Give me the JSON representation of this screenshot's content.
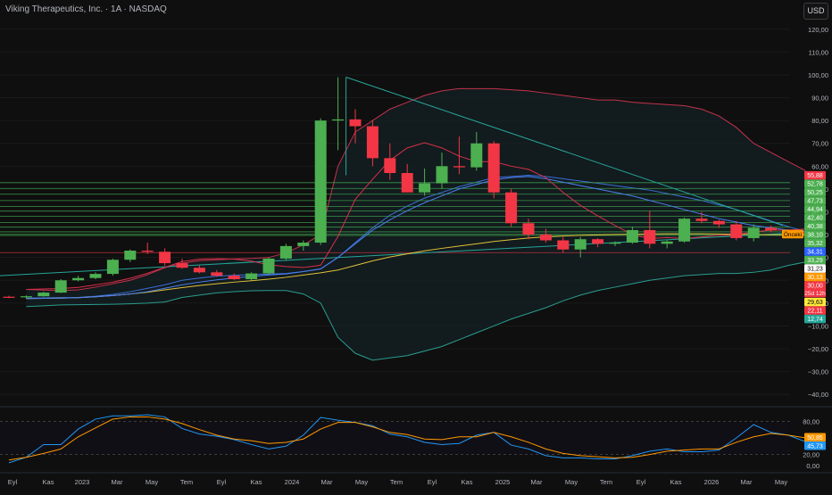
{
  "header": {
    "title": "Viking Therapeutics, Inc. · 1A · NASDAQ",
    "currency_button": "USD"
  },
  "chart_data": {
    "type": "candlestick",
    "title": "Viking Therapeutics, Inc. · 1A · NASDAQ",
    "x_tick_labels": [
      "Eyl",
      "Kas",
      "2023",
      "Mar",
      "May",
      "Tem",
      "Eyl",
      "Kas",
      "2024",
      "Mar",
      "May",
      "Tem",
      "Eyl",
      "Kas",
      "2025",
      "Mar",
      "May",
      "Tem",
      "Eyl",
      "Kas",
      "2026",
      "Mar",
      "May"
    ],
    "y_ticks": [
      120,
      110,
      100,
      90,
      80,
      70,
      60,
      50,
      40,
      30,
      20,
      10,
      0,
      -10,
      -20,
      -30,
      -40
    ],
    "y_tick_labels": [
      "120,00",
      "110,00",
      "100,00",
      "90,00",
      "80,00",
      "70,00",
      "60,00",
      "50,00",
      "40,00",
      "30,00",
      "20,00",
      "10,00",
      "0,0000",
      "−10,00",
      "−20,00",
      "−30,00",
      "−40,00"
    ],
    "ylim": [
      -45,
      125
    ],
    "candles": [
      {
        "o": 2.8,
        "h": 3.2,
        "l": 2.2,
        "c": 2.6
      },
      {
        "o": 2.6,
        "h": 3.4,
        "l": 2.1,
        "c": 3.0
      },
      {
        "o": 3.0,
        "h": 5.0,
        "l": 2.8,
        "c": 4.6
      },
      {
        "o": 4.6,
        "h": 10.5,
        "l": 4.4,
        "c": 10.0
      },
      {
        "o": 10.0,
        "h": 12.0,
        "l": 9.5,
        "c": 11.0
      },
      {
        "o": 11.0,
        "h": 13.5,
        "l": 10.5,
        "c": 12.8
      },
      {
        "o": 12.8,
        "h": 19.5,
        "l": 12.0,
        "c": 19.0
      },
      {
        "o": 19.0,
        "h": 23.5,
        "l": 18.0,
        "c": 23.0
      },
      {
        "o": 23.0,
        "h": 26.5,
        "l": 21.5,
        "c": 22.5
      },
      {
        "o": 22.5,
        "h": 24.0,
        "l": 16.5,
        "c": 17.5
      },
      {
        "o": 17.5,
        "h": 19.5,
        "l": 15.0,
        "c": 15.5
      },
      {
        "o": 15.5,
        "h": 16.5,
        "l": 13.0,
        "c": 13.5
      },
      {
        "o": 13.5,
        "h": 14.5,
        "l": 11.5,
        "c": 12.0
      },
      {
        "o": 12.0,
        "h": 13.0,
        "l": 10.0,
        "c": 10.5
      },
      {
        "o": 10.5,
        "h": 13.5,
        "l": 10.0,
        "c": 13.0
      },
      {
        "o": 13.0,
        "h": 20.0,
        "l": 12.5,
        "c": 19.5
      },
      {
        "o": 19.5,
        "h": 26.0,
        "l": 18.5,
        "c": 25.0
      },
      {
        "o": 25.0,
        "h": 27.5,
        "l": 23.0,
        "c": 26.5
      },
      {
        "o": 26.5,
        "h": 81.0,
        "l": 25.5,
        "c": 80.0
      },
      {
        "o": 80.0,
        "h": 99.0,
        "l": 67.0,
        "c": 80.5
      },
      {
        "o": 80.5,
        "h": 85.0,
        "l": 70.0,
        "c": 77.5
      },
      {
        "o": 77.5,
        "h": 80.0,
        "l": 60.0,
        "c": 63.5
      },
      {
        "o": 63.5,
        "h": 70.0,
        "l": 54.0,
        "c": 57.0
      },
      {
        "o": 57.0,
        "h": 61.0,
        "l": 49.0,
        "c": 48.5
      },
      {
        "o": 48.5,
        "h": 59.0,
        "l": 47.0,
        "c": 52.5
      },
      {
        "o": 52.5,
        "h": 66.0,
        "l": 50.0,
        "c": 60.0
      },
      {
        "o": 60.0,
        "h": 73.0,
        "l": 56.5,
        "c": 59.5
      },
      {
        "o": 59.5,
        "h": 75.0,
        "l": 58.0,
        "c": 70.0
      },
      {
        "o": 70.0,
        "h": 71.0,
        "l": 46.0,
        "c": 48.5
      },
      {
        "o": 48.5,
        "h": 50.0,
        "l": 33.5,
        "c": 35.0
      },
      {
        "o": 35.0,
        "h": 37.0,
        "l": 28.0,
        "c": 30.0
      },
      {
        "o": 30.0,
        "h": 32.5,
        "l": 26.5,
        "c": 27.5
      },
      {
        "o": 27.5,
        "h": 29.0,
        "l": 22.0,
        "c": 23.5
      },
      {
        "o": 23.5,
        "h": 29.0,
        "l": 20.0,
        "c": 28.0
      },
      {
        "o": 28.0,
        "h": 28.5,
        "l": 24.5,
        "c": 26.0
      },
      {
        "o": 26.0,
        "h": 27.0,
        "l": 25.0,
        "c": 26.5
      },
      {
        "o": 26.5,
        "h": 33.5,
        "l": 26.0,
        "c": 32.0
      },
      {
        "o": 32.0,
        "h": 40.5,
        "l": 24.0,
        "c": 26.0
      },
      {
        "o": 26.0,
        "h": 27.5,
        "l": 24.0,
        "c": 27.0
      },
      {
        "o": 27.0,
        "h": 37.5,
        "l": 26.5,
        "c": 37.0
      },
      {
        "o": 37.0,
        "h": 40.0,
        "l": 35.0,
        "c": 36.0
      },
      {
        "o": 36.0,
        "h": 36.5,
        "l": 33.0,
        "c": 34.5
      },
      {
        "o": 34.5,
        "h": 36.0,
        "l": 27.5,
        "c": 28.5
      },
      {
        "o": 28.5,
        "h": 34.5,
        "l": 27.0,
        "c": 33.0
      },
      {
        "o": 33.0,
        "h": 34.0,
        "l": 31.0,
        "c": 31.8
      },
      {
        "o": 31.8,
        "h": 32.5,
        "l": 30.5,
        "c": 31.0
      },
      {
        "o": 31.0,
        "h": 31.5,
        "l": 29.5,
        "c": 30.0
      }
    ],
    "bollinger_upper": [
      6,
      5.7,
      5.5,
      5.8,
      7,
      8.5,
      10,
      12.5,
      15.5,
      17.5,
      18.6,
      19,
      19.4,
      19.6,
      20,
      22,
      25.5,
      30,
      60,
      75,
      80,
      85,
      88,
      91,
      93,
      94,
      94,
      94,
      93.5,
      93,
      92,
      91,
      90,
      89,
      89,
      88,
      87.5,
      87,
      86.5,
      85,
      82,
      77,
      70,
      66,
      62,
      58
    ],
    "bollinger_middle": [
      2.2,
      2.3,
      2.4,
      2.5,
      3,
      3.8,
      5,
      6.5,
      8,
      10,
      11,
      11.8,
      12.2,
      12.5,
      12.7,
      13,
      13.8,
      15,
      20,
      26.5,
      33,
      38.5,
      42.5,
      46,
      48.5,
      51,
      53,
      55,
      55.5,
      56,
      55.5,
      54.5,
      53.5,
      52.5,
      51.5,
      50.5,
      49.5,
      48,
      46.5,
      45,
      43,
      41,
      38.5,
      36,
      33.5,
      31.5
    ],
    "bollinger_lower": [
      -1.5,
      -1.2,
      -0.8,
      -0.7,
      -0.6,
      -0.5,
      -0.3,
      0,
      0.5,
      2.5,
      3.5,
      4.5,
      5,
      5.4,
      5.5,
      5.5,
      4,
      0,
      -15,
      -22,
      -25,
      -24,
      -23,
      -21,
      -19,
      -16,
      -13,
      -10,
      -7,
      -4.5,
      -2,
      1,
      3.5,
      5.5,
      7,
      8.5,
      10,
      11,
      12,
      12.5,
      13,
      13,
      13.5,
      14.5,
      16.5,
      18
    ],
    "series_ma_yellow": [
      2,
      2.1,
      2.2,
      2.4,
      2.8,
      3.3,
      4,
      4.8,
      5.8,
      6.8,
      7.7,
      8.5,
      9.2,
      9.8,
      10.5,
      11.3,
      12.3,
      13.3,
      14.5,
      16.5,
      18.5,
      20.2,
      21.6,
      22.9,
      24,
      25,
      26,
      27,
      27.8,
      28.5,
      29,
      29.4,
      29.7,
      29.9,
      30.1,
      30.2,
      30.3,
      30.4,
      30.4,
      30.4,
      30.3,
      30.2,
      30.1,
      30,
      29.9,
      29.8
    ],
    "series_ma_blue": [
      2,
      2.1,
      2.2,
      2.4,
      2.8,
      3.3,
      4,
      5,
      6.5,
      8,
      9.2,
      10.2,
      11,
      11.7,
      12.3,
      12.8,
      13.8,
      15,
      20,
      26,
      32,
      36.5,
      40.5,
      44,
      47,
      50,
      52,
      54,
      55,
      55.5,
      54.5,
      53,
      51.5,
      50,
      48.5,
      47,
      45,
      43,
      41,
      39,
      37,
      35.5,
      34,
      33,
      32,
      31.3
    ],
    "ma_red_short": [
      6,
      6.2,
      6.4,
      6.9,
      8,
      9.2,
      10.9,
      13.1,
      15.7,
      18.2,
      19.3,
      19.5,
      19.3,
      18.4,
      16.8,
      16,
      15.6,
      16.6,
      29.2,
      45.5,
      54.3,
      62.6,
      68,
      70.3,
      68,
      64.4,
      62,
      62,
      60,
      58.6,
      55,
      48.5,
      42.8,
      38.2,
      34,
      30,
      28.3,
      28.7,
      28.3,
      29,
      29.7,
      30,
      31.2,
      32,
      32,
      32.5
    ],
    "trend_line_top": [
      [
        98.5,
        99
      ],
      [
        438,
        34
      ]
    ],
    "trend_line_bottom": [
      [
        0,
        12
      ],
      [
        438,
        30.5
      ]
    ],
    "horizontal_levels": [
      52.78,
      50.25,
      47.73,
      44.94,
      42.4,
      40.38,
      38.1,
      35.32,
      33.29,
      31.23,
      30.13,
      29.63
    ],
    "red_level": 22.11,
    "price_labels": [
      {
        "value": 55.88,
        "label": "55,88",
        "color": "#f23645"
      },
      {
        "value": 52.78,
        "label": "52,78",
        "color": "#4caf50"
      },
      {
        "value": 50.25,
        "label": "50,25",
        "color": "#4caf50"
      },
      {
        "value": 47.73,
        "label": "47,73",
        "color": "#4caf50"
      },
      {
        "value": 44.94,
        "label": "44,94",
        "color": "#4caf50"
      },
      {
        "value": 42.4,
        "label": "42,40",
        "color": "#4caf50"
      },
      {
        "value": 40.38,
        "label": "40,38",
        "color": "#4caf50"
      },
      {
        "value": 38.1,
        "label": "38,10",
        "color": "#4caf50"
      },
      {
        "value": 35.32,
        "label": "35,32",
        "color": "#4caf50"
      },
      {
        "value": 34.31,
        "label": "34,31",
        "color": "#2962ff"
      },
      {
        "value": 33.29,
        "label": "33,29",
        "color": "#4caf50"
      },
      {
        "value": 31.23,
        "label": "31,23",
        "color": "#ffffff"
      },
      {
        "value": 30.13,
        "label": "30,13",
        "color": "#ff9800"
      },
      {
        "value": 30.0,
        "label": "30,00",
        "color": "#f23645",
        "sub": "25d 12h"
      },
      {
        "value": 29.63,
        "label": "29,63",
        "color": "#ffeb3b"
      },
      {
        "value": 22.11,
        "label": "22,11",
        "color": "#f23645"
      },
      {
        "value": 12.74,
        "label": "12,74",
        "color": "#26a69a"
      }
    ],
    "price_flag_label": "Önceki",
    "oscillator": {
      "y_ticks": [
        80,
        20
      ],
      "y_tick_labels": [
        "80,00",
        "20,00",
        "0,00"
      ],
      "ylim": [
        0,
        100
      ],
      "blue": [
        5,
        15,
        38,
        38,
        66,
        84,
        90,
        90,
        92,
        88,
        67,
        57,
        53,
        47,
        38,
        30,
        35,
        55,
        87,
        82,
        78,
        72,
        57,
        52,
        42,
        38,
        40,
        55,
        60,
        37,
        30,
        18,
        14,
        14,
        12,
        12,
        18,
        26,
        30,
        25,
        25,
        28,
        50,
        74,
        60,
        55,
        43
      ],
      "orange": [
        10,
        15,
        22,
        30,
        52,
        68,
        84,
        88,
        88,
        84,
        76,
        65,
        55,
        48,
        45,
        40,
        42,
        48,
        66,
        78,
        78,
        70,
        60,
        56,
        48,
        47,
        52,
        52,
        60,
        52,
        42,
        30,
        22,
        18,
        16,
        14,
        15,
        20,
        26,
        28,
        30,
        30,
        42,
        52,
        58,
        55,
        50
      ],
      "labels": [
        {
          "value": 50.85,
          "label": "50,85",
          "color": "#ff9800"
        },
        {
          "value": 45.73,
          "label": "45,73",
          "color": "#2196f3"
        }
      ]
    }
  }
}
